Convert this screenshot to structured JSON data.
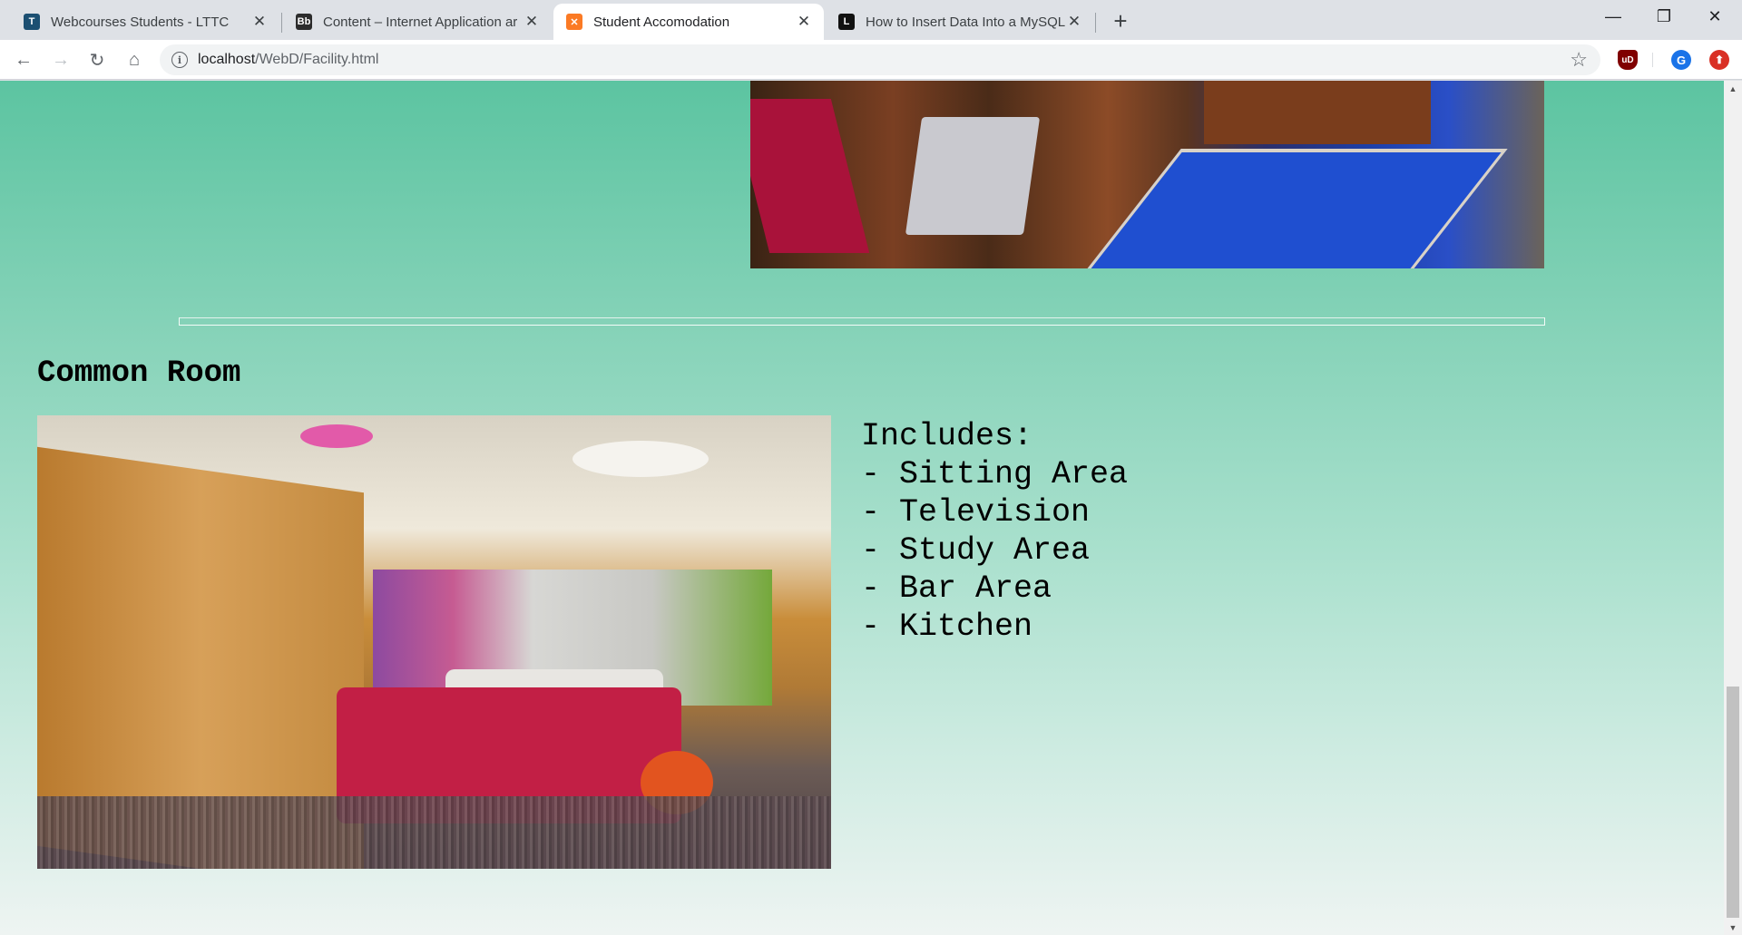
{
  "browser": {
    "tabs": [
      {
        "title": "Webcourses Students - LTTC",
        "favicon": "webcourses-icon",
        "color": "#1b4f72"
      },
      {
        "title": "Content – Internet Application ar",
        "favicon": "blackboard-icon",
        "color": "#2c2c2c"
      },
      {
        "title": "Student Accomodation",
        "favicon": "xampp-icon",
        "color": "#fb7a24"
      },
      {
        "title": "How to Insert Data Into a MySQL",
        "favicon": "lifewire-icon",
        "color": "#111111"
      }
    ],
    "address": {
      "host": "localhost",
      "path": "/WebD/Facility.html"
    },
    "extensions": {
      "ublock": "uD",
      "account": "G"
    }
  },
  "page": {
    "section_title": "Common Room",
    "includes_label": "Includes:",
    "features": [
      "- Sitting Area",
      "- Television",
      "- Study Area",
      "- Bar Area",
      "- Kitchen"
    ],
    "images": {
      "top": "game-room-photo",
      "common": "common-room-photo"
    }
  },
  "colors": {
    "page_gradient_top": "#5cc4a1",
    "page_gradient_bottom": "#eef4f2",
    "active_tab": "#ffffff",
    "tab_strip": "#dee1e6"
  }
}
